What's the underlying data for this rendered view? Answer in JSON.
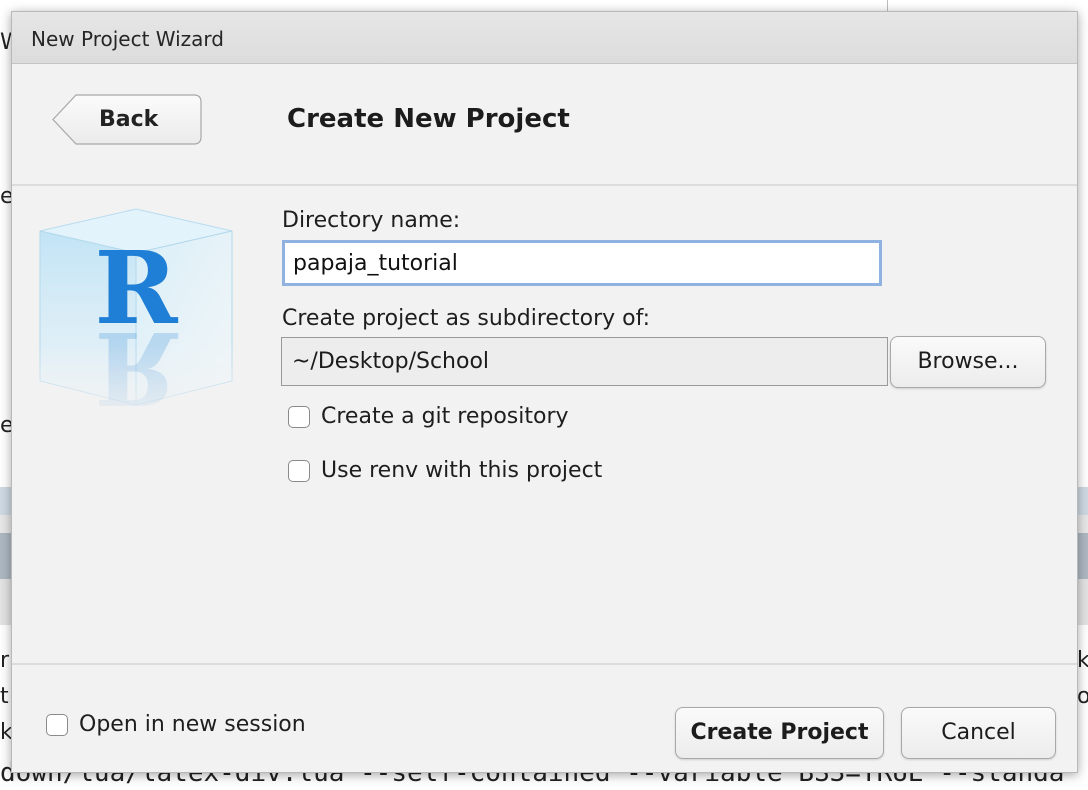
{
  "window": {
    "title": "New Project Wizard"
  },
  "header": {
    "back_label": "Back",
    "title": "Create New Project"
  },
  "form": {
    "directory_label": "Directory name:",
    "directory_value": "papaja_tutorial",
    "parent_label": "Create project as subdirectory of:",
    "parent_value": "~/Desktop/School",
    "browse_label": "Browse...",
    "git_label": "Create a git repository",
    "git_checked": false,
    "renv_label": "Use renv with this project",
    "renv_checked": false
  },
  "footer": {
    "new_session_label": "Open in new session",
    "new_session_checked": false,
    "create_label": "Create Project",
    "cancel_label": "Cancel"
  },
  "logo": {
    "letter": "R",
    "icon": "r-project-cube-icon"
  },
  "background": {
    "left_fragments": [
      "W",
      "e",
      "e",
      "r",
      "t",
      "k"
    ],
    "right_fragments": [
      "k",
      "o"
    ],
    "console_line": "down/lua/latex-div.lua --self-contained --variable BS3=TRUE --standa"
  },
  "colors": {
    "dialog_bg": "#f2f2f2",
    "titlebar_bg": "#e1e1e1",
    "focus_border": "#8fb2e0",
    "r_blue": "#1f7fd6"
  }
}
